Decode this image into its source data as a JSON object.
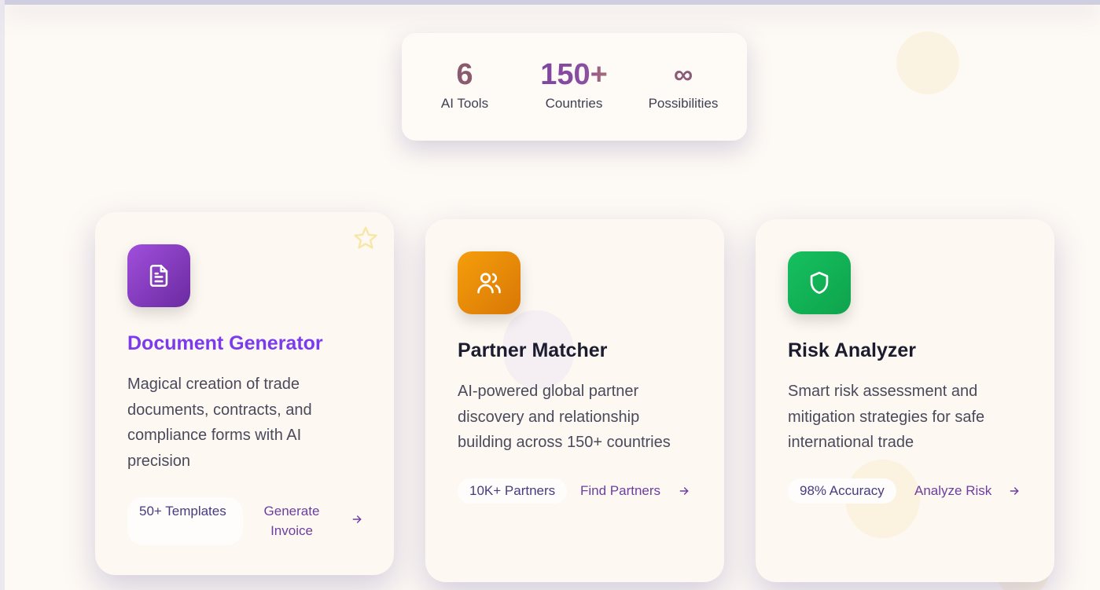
{
  "stats": [
    {
      "value": "6",
      "label": "AI Tools"
    },
    {
      "value": "150+",
      "label": "Countries"
    },
    {
      "value": "∞",
      "label": "Possibilities"
    }
  ],
  "cards": [
    {
      "icon": "document-icon",
      "title": "Document Generator",
      "description": "Magical creation of trade documents, contracts, and compliance forms with AI precision",
      "badge": "50+ Templates",
      "action": "Generate Invoice"
    },
    {
      "icon": "users-icon",
      "title": "Partner Matcher",
      "description": "AI-powered global partner discovery and relationship building across 150+ countries",
      "badge": "10K+ Partners",
      "action": "Find Partners"
    },
    {
      "icon": "shield-icon",
      "title": "Risk Analyzer",
      "description": "Smart risk assessment and mitigation strategies for safe international trade",
      "badge": "98% Accuracy",
      "action": "Analyze Risk"
    }
  ],
  "colors": {
    "document_accent": "#7c3aed",
    "partner_icon": "#f59e0b",
    "risk_icon": "#16c060"
  }
}
